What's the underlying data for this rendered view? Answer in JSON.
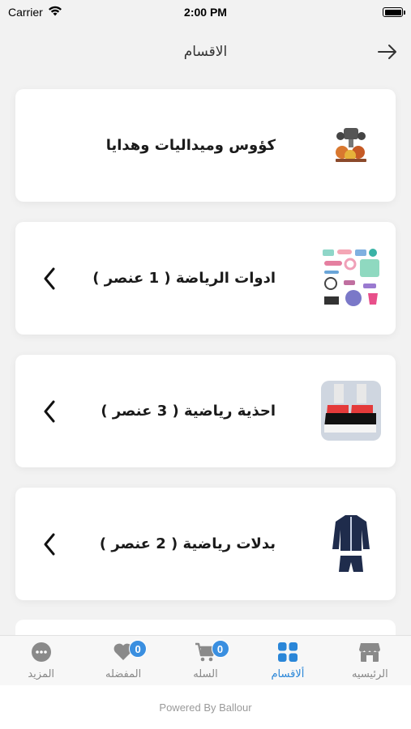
{
  "status_bar": {
    "carrier": "Carrier",
    "time": "2:00 PM"
  },
  "header": {
    "title": "الاقسام"
  },
  "categories": [
    {
      "label": "كؤوس وميداليات وهدايا",
      "thumb": "trophies-image",
      "has_chevron": false
    },
    {
      "label": "ادوات الرياضة ( 1 عنصر )",
      "thumb": "sports-equipment-image",
      "has_chevron": true
    },
    {
      "label": "احذية رياضية ( 3 عنصر )",
      "thumb": "sneakers-image",
      "has_chevron": true
    },
    {
      "label": "بدلات رياضية ( 2 عنصر )",
      "thumb": "tracksuit-image",
      "has_chevron": true
    }
  ],
  "tabbar": {
    "tabs": [
      {
        "label": "المزيد",
        "icon": "more-icon"
      },
      {
        "label": "المفضله",
        "icon": "heart-icon",
        "badge": "0"
      },
      {
        "label": "السله",
        "icon": "cart-icon",
        "badge": "0"
      },
      {
        "label": "ألاقسام",
        "icon": "grid-icon",
        "active": true
      },
      {
        "label": "الرئيسيه",
        "icon": "store-icon"
      }
    ]
  },
  "footer": {
    "text": "Powered By Ballour"
  },
  "colors": {
    "accent": "#2a86d8",
    "badge": "#3a8fe0",
    "inactive": "#888888",
    "background": "#f2f2f2"
  }
}
